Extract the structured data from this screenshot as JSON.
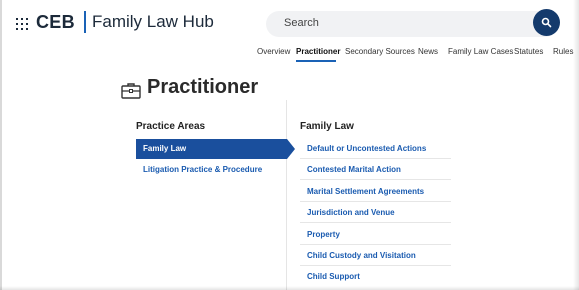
{
  "header": {
    "brand": "CEB",
    "product": "Family Law Hub",
    "search_placeholder": "Search",
    "search_icon": "search-icon"
  },
  "nav": {
    "items": [
      {
        "label": "Overview",
        "active": false
      },
      {
        "label": "Practitioner",
        "active": true
      },
      {
        "label": "Secondary Sources",
        "active": false
      },
      {
        "label": "News",
        "active": false
      },
      {
        "label": "Family Law Cases",
        "active": false
      },
      {
        "label": "Statutes",
        "active": false
      },
      {
        "label": "Rules",
        "active": false
      }
    ]
  },
  "page": {
    "title": "Practitioner",
    "title_icon": "briefcase-icon"
  },
  "practice_areas": {
    "heading": "Practice Areas",
    "items": [
      {
        "label": "Family Law",
        "selected": true
      },
      {
        "label": "Litigation Practice & Procedure",
        "selected": false
      }
    ]
  },
  "family_law": {
    "heading": "Family Law",
    "items": [
      "Default or Uncontested Actions",
      "Contested Marital Action",
      "Marital Settlement Agreements",
      "Jurisdiction and Venue",
      "Property",
      "Child Custody and Visitation",
      "Child Support"
    ]
  },
  "colors": {
    "accent": "#1a62b6",
    "selected_bg": "#1a4f9d",
    "link": "#1a5bb0",
    "search_button": "#143a6c"
  }
}
